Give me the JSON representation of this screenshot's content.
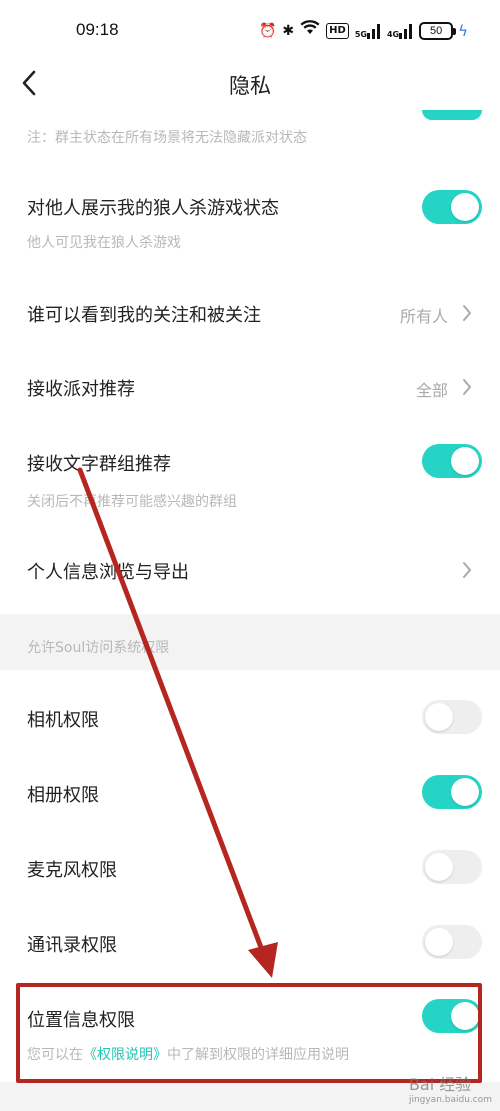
{
  "status_bar": {
    "time": "09:18",
    "icons": [
      "alarm-icon",
      "bluetooth-icon",
      "wifi-icon",
      "hd-icon",
      "signal-5g-icon",
      "signal-4g-icon",
      "battery-icon"
    ],
    "hd_label": "HD",
    "sig1_label": "5G",
    "sig2_label": "4G",
    "battery_level": "50"
  },
  "nav": {
    "title": "隐私",
    "back_icon": "chevron-left-icon"
  },
  "top_note": "注：群主状态在所有场景将无法隐藏派对状态",
  "settings": [
    {
      "id": "werewolf-status",
      "title": "对他人展示我的狼人杀游戏状态",
      "subtitle": "他人可见我在狼人杀游戏",
      "toggle": "on"
    },
    {
      "id": "follow-visibility",
      "title": "谁可以看到我的关注和被关注",
      "value": "所有人"
    },
    {
      "id": "party-recommend",
      "title": "接收派对推荐",
      "value": "全部"
    },
    {
      "id": "group-recommend",
      "title": "接收文字群组推荐",
      "subtitle": "关闭后不再推荐可能感兴趣的群组",
      "toggle": "on"
    },
    {
      "id": "personal-info",
      "title": "个人信息浏览与导出"
    }
  ],
  "permissions_section": {
    "header": "允许Soul访问系统权限",
    "items": [
      {
        "id": "camera",
        "title": "相机权限",
        "toggle": "off"
      },
      {
        "id": "album",
        "title": "相册权限",
        "toggle": "on"
      },
      {
        "id": "microphone",
        "title": "麦克风权限",
        "toggle": "off"
      },
      {
        "id": "contacts",
        "title": "通讯录权限",
        "toggle": "off"
      },
      {
        "id": "location",
        "title": "位置信息权限",
        "toggle": "on",
        "subtitle_before": "您可以在",
        "subtitle_link": "《权限说明》",
        "subtitle_after": "中了解到权限的详细应用说明"
      }
    ]
  },
  "colors": {
    "accent": "#25d4c4",
    "annotation": "#b62621",
    "subtitle": "#b8b8b8",
    "section_bg": "#f3f3f3"
  },
  "watermark": {
    "text": "Bai 经验",
    "sub": "jingyan.baidu.com"
  }
}
